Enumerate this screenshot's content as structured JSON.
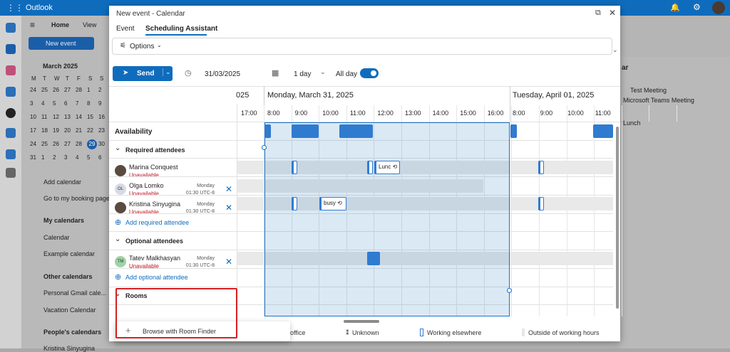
{
  "outlook": {
    "app_name": "Outlook",
    "ribbon_tabs": [
      "Home",
      "View"
    ],
    "new_event_label": "New event",
    "mini_cal_title": "March 2025",
    "weekdays": [
      "M",
      "T",
      "W",
      "T",
      "F",
      "S",
      "S"
    ],
    "weeks": [
      [
        "24",
        "25",
        "26",
        "27",
        "28",
        "1",
        "2"
      ],
      [
        "3",
        "4",
        "5",
        "6",
        "7",
        "8",
        "9"
      ],
      [
        "10",
        "11",
        "12",
        "13",
        "14",
        "15",
        "16"
      ],
      [
        "17",
        "18",
        "19",
        "20",
        "21",
        "22",
        "23"
      ],
      [
        "24",
        "25",
        "26",
        "27",
        "28",
        "29",
        "30"
      ],
      [
        "31",
        "1",
        "2",
        "3",
        "4",
        "5",
        "6"
      ]
    ],
    "today": "29",
    "links": [
      "Add calendar",
      "Go to my booking page"
    ],
    "groups": {
      "my_calendars": "My calendars",
      "my_items": [
        "Calendar",
        "Example calendar"
      ],
      "other_calendars": "Other calendars",
      "other_items": [
        "Personal Gmail cale...",
        "Vacation Calendar"
      ],
      "peoples": "People's calendars",
      "peoples_item": "Kristina Sinyugina"
    },
    "right_pane": {
      "heading_fragment": "ar",
      "event1_title": "Test Meeting",
      "event1_sub": "Microsoft Teams Meeting",
      "event2_title": "Lunch"
    }
  },
  "modal": {
    "title": "New event - Calendar",
    "tabs": [
      "Event",
      "Scheduling Assistant"
    ],
    "options_label": "Options",
    "send_label": "Send",
    "date": "31/03/2025",
    "duration": "1 day",
    "all_day_label": "All day",
    "year_fragment": "025",
    "day1": "Monday, March 31, 2025",
    "day2": "Tuesday, April 01, 2025",
    "hours_prev": "17:00",
    "hours_day1": [
      "8:00",
      "9:00",
      "10:00",
      "11:00",
      "12:00",
      "13:00",
      "14:00",
      "15:00",
      "16:00"
    ],
    "hours_day2": [
      "8:00",
      "9:00",
      "10:00",
      "11:00"
    ],
    "availability_label": "Availability",
    "required_label": "Required attendees",
    "optional_label": "Optional attendees",
    "rooms_label": "Rooms",
    "add_required": "Add required attendee",
    "add_optional": "Add optional attendee",
    "browse_rooms": "Browse with Room Finder",
    "attendees": [
      {
        "name": "Marina Conquest",
        "status": "Unavailable",
        "initials": "",
        "tz_day": "",
        "tz_time": ""
      },
      {
        "name": "Olga Lomko",
        "status": "Unavailable",
        "initials": "OL",
        "tz_day": "Monday",
        "tz_time": "01:30 UTC-8"
      },
      {
        "name": "Kristina Sinyugina",
        "status": "Unavailable",
        "initials": "",
        "tz_day": "Monday",
        "tz_time": "01:30 UTC-8"
      }
    ],
    "optional_attendees": [
      {
        "name": "Tatev Malkhasyan",
        "status": "Unavailable",
        "initials": "TM",
        "tz_day": "Monday",
        "tz_time": "01:30 UTC-8"
      }
    ],
    "event_chips": {
      "lunch": "Lunc",
      "busy": "busy"
    },
    "legend": [
      "office",
      "Unknown",
      "Working elsewhere",
      "Outside of working hours"
    ]
  }
}
